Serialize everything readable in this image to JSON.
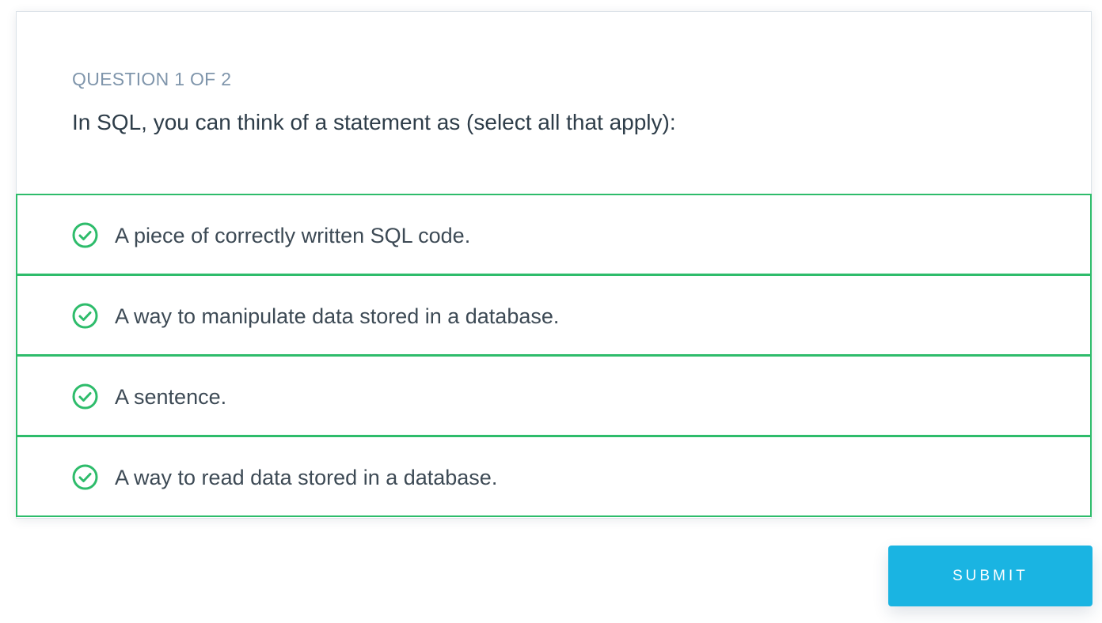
{
  "quiz": {
    "counter": "QUESTION 1 OF 2",
    "question": "In SQL, you can think of a statement as (select all that apply):",
    "options": [
      {
        "label": "A piece of correctly written SQL code.",
        "selected": true
      },
      {
        "label": "A way to manipulate data stored in a database.",
        "selected": true
      },
      {
        "label": "A sentence.",
        "selected": true
      },
      {
        "label": "A way to read data stored in a database.",
        "selected": true
      }
    ],
    "submit_label": "SUBMIT"
  },
  "colors": {
    "accent_green": "#2ebc6b",
    "submit_blue": "#1ab4e2",
    "counter_gray": "#7f95ab",
    "text_dark": "#2e3d49"
  },
  "icons": {
    "option_check": "check-circle-icon"
  }
}
